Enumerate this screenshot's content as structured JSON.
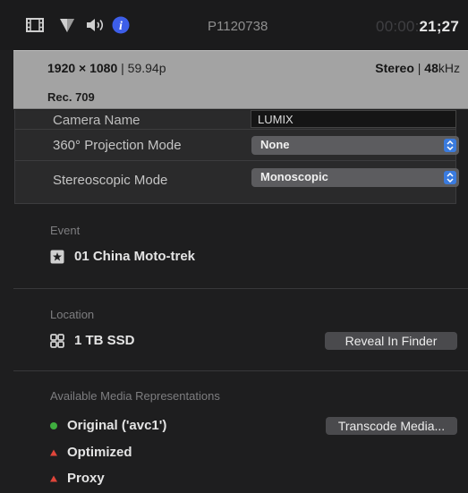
{
  "toolbar": {
    "clip_name": "P1120738",
    "timecode_dim": "00:00:",
    "timecode_bright": "21;27",
    "icons": [
      "film-icon",
      "filter-icon",
      "audio-icon",
      "info-icon"
    ]
  },
  "info_panel": {
    "resolution": "1920 × 1080",
    "frame_rate": "59.94p",
    "audio_channels": "Stereo",
    "sample_rate_value": "48",
    "sample_rate_unit": "kHz",
    "color_space": "Rec. 709"
  },
  "metadata": {
    "rows": [
      {
        "label": "Camera Name",
        "value": "LUMIX"
      },
      {
        "label": "360° Projection Mode",
        "value": "None"
      },
      {
        "label": "Stereoscopic Mode",
        "value": "Monoscopic"
      }
    ]
  },
  "event": {
    "label": "Event",
    "name": "01 China Moto-trek"
  },
  "location": {
    "label": "Location",
    "name": "1 TB SSD",
    "button": "Reveal In Finder"
  },
  "media": {
    "label": "Available Media Representations",
    "button": "Transcode Media...",
    "items": [
      {
        "name": "Original ('avc1')",
        "status": "available",
        "color": "#3fae3f"
      },
      {
        "name": "Optimized",
        "status": "missing",
        "color": "#e0453a"
      },
      {
        "name": "Proxy",
        "status": "missing",
        "color": "#e0453a"
      }
    ]
  },
  "colors": {
    "background": "#1e1e1f",
    "info_icon": "#3d5ee8",
    "popup_chevron": "#3a7bdf"
  }
}
